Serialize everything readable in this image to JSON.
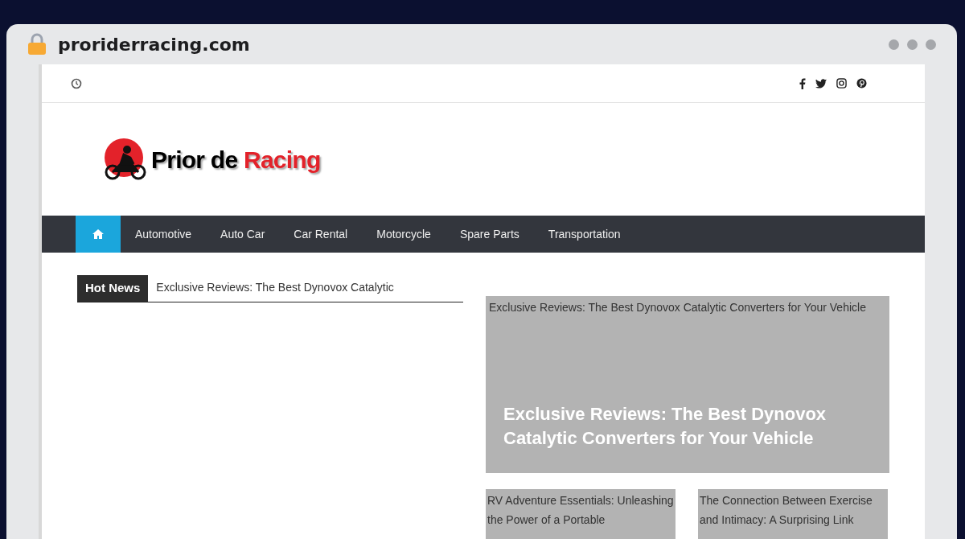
{
  "browser": {
    "url": "proriderracing.com"
  },
  "logo": {
    "text_dark": "Prior de",
    "text_accent": "Racing"
  },
  "nav": {
    "items": [
      {
        "kind": "home",
        "selected": true
      },
      {
        "kind": "link",
        "label": "Automotive",
        "selected": false
      },
      {
        "kind": "link",
        "label": "Auto Car",
        "selected": false
      },
      {
        "kind": "link",
        "label": "Car Rental",
        "selected": false
      },
      {
        "kind": "link",
        "label": "Motorcycle",
        "selected": false
      },
      {
        "kind": "link",
        "label": "Spare Parts",
        "selected": false
      },
      {
        "kind": "link",
        "label": "Transportation",
        "selected": false
      }
    ]
  },
  "hot_news": {
    "label": "Hot News",
    "headline": "Exclusive Reviews: The Best Dynovox Catalytic"
  },
  "featured": {
    "alt_text": "Exclusive Reviews: The Best Dynovox Catalytic Converters for Your Vehicle",
    "title": "Exclusive Reviews: The Best Dynovox Catalytic Converters for Your Vehicle"
  },
  "cards": [
    {
      "alt_text": "RV Adventure Essentials: Unleashing the Power of a Portable"
    },
    {
      "alt_text": "The Connection Between Exercise and Intimacy: A Surprising Link"
    }
  ]
}
